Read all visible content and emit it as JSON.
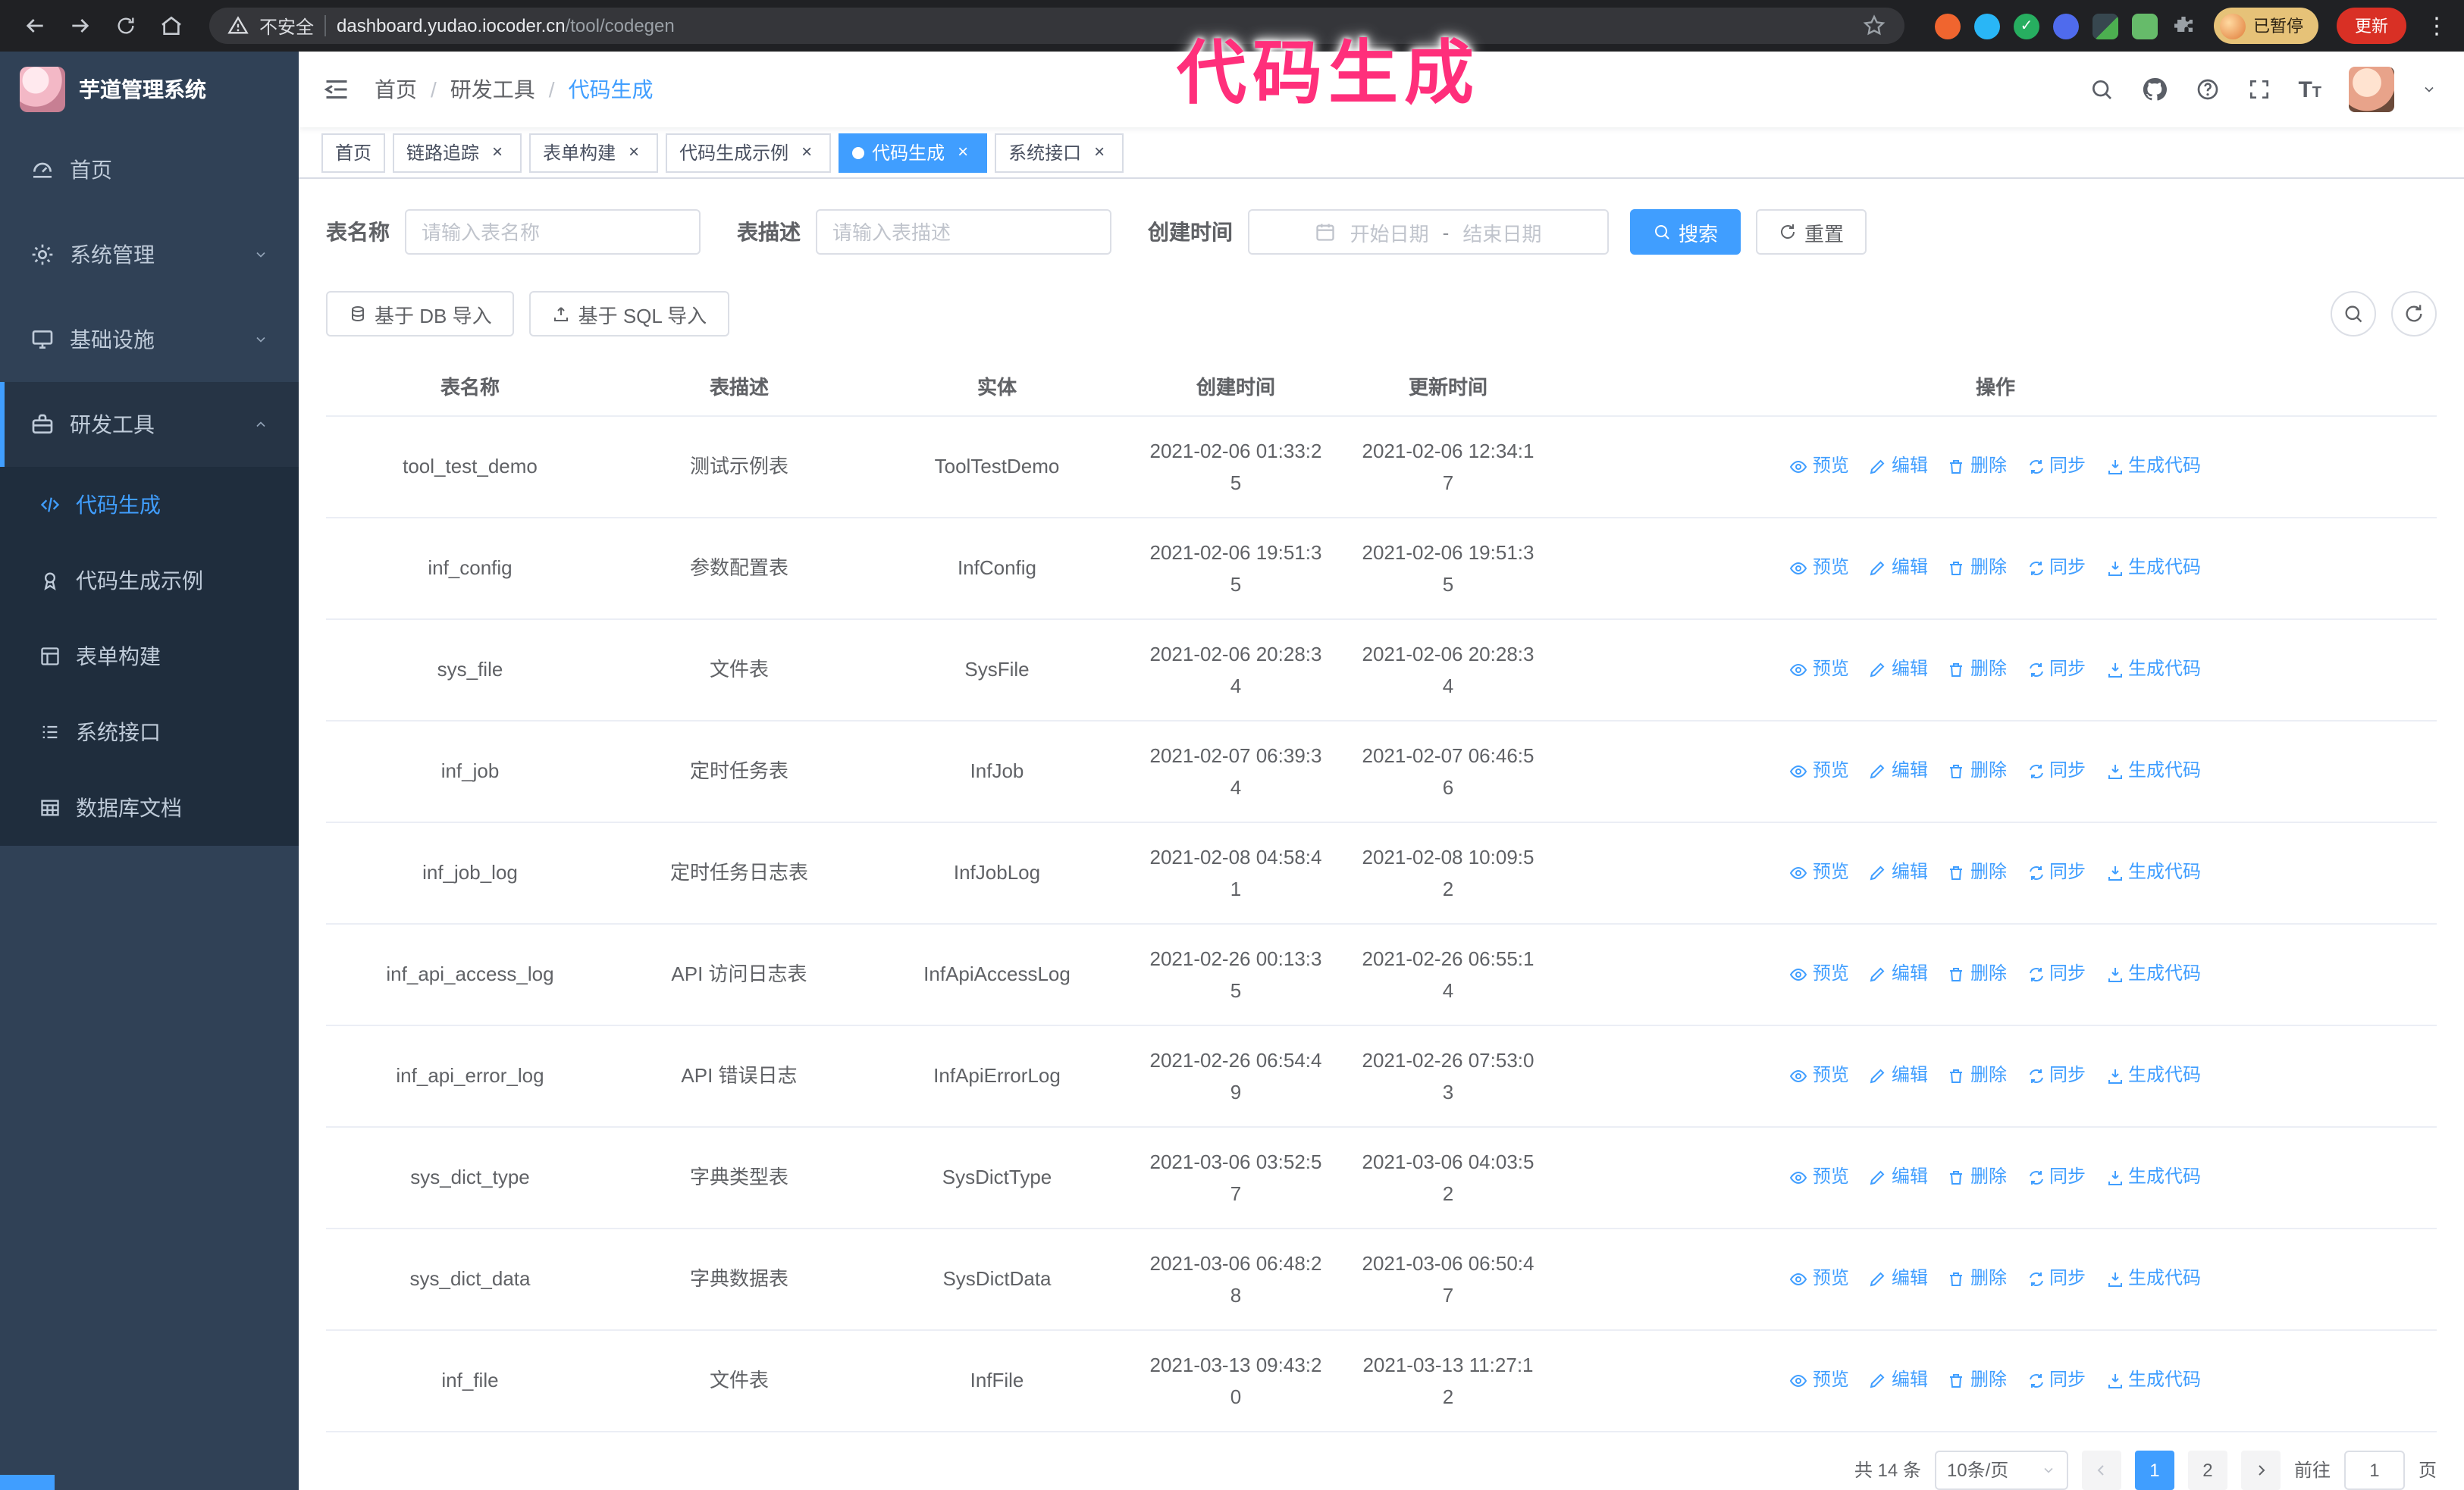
{
  "browser": {
    "security_label": "不安全",
    "url_host": "dashboard.yudao.iocoder.cn",
    "url_path": "/tool/codegen",
    "profile_badge": "已暂停",
    "update_button": "更新"
  },
  "annotation": {
    "text": "代码生成",
    "color": "#ff2f7b"
  },
  "colors": {
    "accent": "#409eff",
    "sidebar_bg": "#304156",
    "submenu_bg": "#1f2d3d",
    "table_border": "#ebeef5"
  },
  "sidebar": {
    "logo_title": "芋道管理系统",
    "items": [
      {
        "label": "首页",
        "icon": "dashboard-icon"
      },
      {
        "label": "系统管理",
        "icon": "gear-icon",
        "expandable": true
      },
      {
        "label": "基础设施",
        "icon": "monitor-icon",
        "expandable": true
      },
      {
        "label": "研发工具",
        "icon": "toolbox-icon",
        "expandable": true,
        "expanded": true,
        "children": [
          {
            "label": "代码生成",
            "icon": "code-icon",
            "active": true
          },
          {
            "label": "代码生成示例",
            "icon": "badge-icon"
          },
          {
            "label": "表单构建",
            "icon": "form-icon"
          },
          {
            "label": "系统接口",
            "icon": "api-icon"
          },
          {
            "label": "数据库文档",
            "icon": "table-icon"
          }
        ]
      }
    ]
  },
  "navbar": {
    "breadcrumb": [
      "首页",
      "研发工具",
      "代码生成"
    ],
    "icons": [
      "search-icon",
      "github-icon",
      "help-icon",
      "fullscreen-icon",
      "font-size-icon",
      "avatar",
      "caret-down-icon"
    ]
  },
  "tabs": [
    {
      "label": "首页",
      "closable": false,
      "active": false
    },
    {
      "label": "链路追踪",
      "closable": true,
      "active": false
    },
    {
      "label": "表单构建",
      "closable": true,
      "active": false
    },
    {
      "label": "代码生成示例",
      "closable": true,
      "active": false
    },
    {
      "label": "代码生成",
      "closable": true,
      "active": true
    },
    {
      "label": "系统接口",
      "closable": true,
      "active": false
    }
  ],
  "filters": {
    "table_name_label": "表名称",
    "table_name_placeholder": "请输入表名称",
    "table_desc_label": "表描述",
    "table_desc_placeholder": "请输入表描述",
    "create_time_label": "创建时间",
    "date_start_placeholder": "开始日期",
    "date_separator": "-",
    "date_end_placeholder": "结束日期",
    "search_button": "搜索",
    "reset_button": "重置"
  },
  "toolbar": {
    "import_db_button": "基于 DB 导入",
    "import_sql_button": "基于 SQL 导入"
  },
  "table": {
    "columns": [
      "表名称",
      "表描述",
      "实体",
      "创建时间",
      "更新时间",
      "操作"
    ],
    "actions": [
      "预览",
      "编辑",
      "删除",
      "同步",
      "生成代码"
    ],
    "action_icons": [
      "eye-icon",
      "edit-icon",
      "delete-icon",
      "sync-icon",
      "download-icon"
    ],
    "rows": [
      [
        "tool_test_demo",
        "测试示例表",
        "ToolTestDemo",
        "2021-02-06 01:33:25",
        "2021-02-06 12:34:17"
      ],
      [
        "inf_config",
        "参数配置表",
        "InfConfig",
        "2021-02-06 19:51:35",
        "2021-02-06 19:51:35"
      ],
      [
        "sys_file",
        "文件表",
        "SysFile",
        "2021-02-06 20:28:34",
        "2021-02-06 20:28:34"
      ],
      [
        "inf_job",
        "定时任务表",
        "InfJob",
        "2021-02-07 06:39:34",
        "2021-02-07 06:46:56"
      ],
      [
        "inf_job_log",
        "定时任务日志表",
        "InfJobLog",
        "2021-02-08 04:58:41",
        "2021-02-08 10:09:52"
      ],
      [
        "inf_api_access_log",
        "API 访问日志表",
        "InfApiAccessLog",
        "2021-02-26 00:13:35",
        "2021-02-26 06:55:14"
      ],
      [
        "inf_api_error_log",
        "API 错误日志",
        "InfApiErrorLog",
        "2021-02-26 06:54:49",
        "2021-02-26 07:53:03"
      ],
      [
        "sys_dict_type",
        "字典类型表",
        "SysDictType",
        "2021-03-06 03:52:57",
        "2021-03-06 04:03:52"
      ],
      [
        "sys_dict_data",
        "字典数据表",
        "SysDictData",
        "2021-03-06 06:48:28",
        "2021-03-06 06:50:47"
      ],
      [
        "inf_file",
        "文件表",
        "InfFile",
        "2021-03-13 09:43:20",
        "2021-03-13 11:27:12"
      ]
    ]
  },
  "pagination": {
    "total_text": "共 14 条",
    "page_size": "10条/页",
    "pages": [
      "1",
      "2"
    ],
    "active_page": "1",
    "goto_label": "前往",
    "goto_value": "1",
    "goto_suffix": "页"
  }
}
